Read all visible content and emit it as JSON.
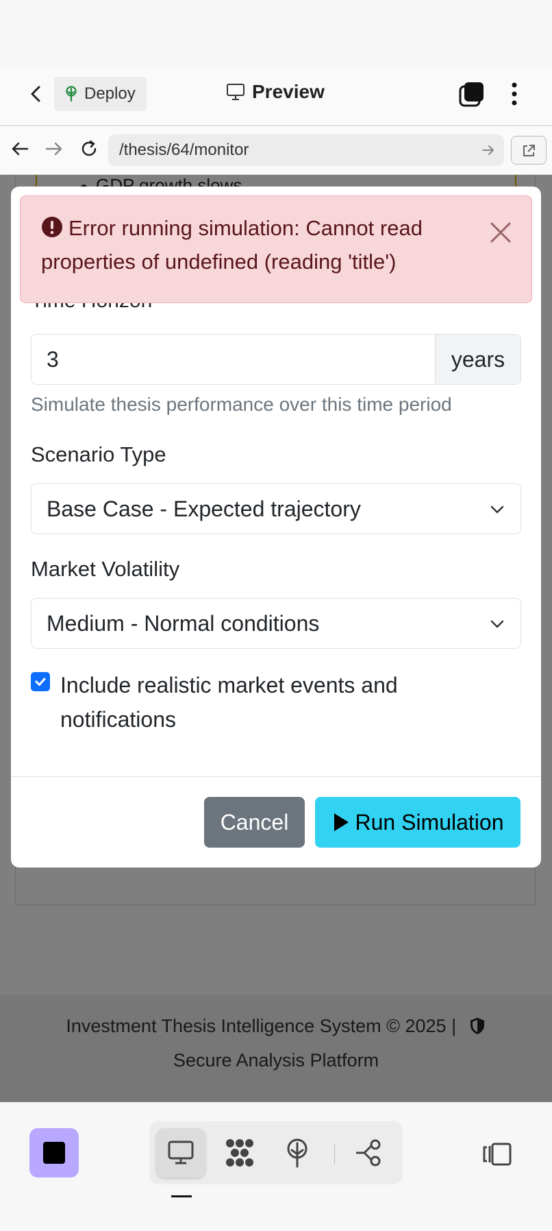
{
  "topbar": {
    "deploy_label": "Deploy",
    "preview_label": "Preview"
  },
  "addressbar": {
    "url": "/thesis/64/monitor"
  },
  "background_page": {
    "bullet_text": "GDP growth slows",
    "footer_line1": "Investment Thesis Intelligence System © 2025   |",
    "footer_line2": "Secure Analysis Platform"
  },
  "modal": {
    "peek_label": "Time Horizon",
    "alert": {
      "message": "Error running simulation: Cannot read properties of undefined (reading 'title')"
    },
    "time_horizon": {
      "value": "3",
      "unit": "years",
      "help": "Simulate thesis performance over this time period"
    },
    "scenario": {
      "label": "Scenario Type",
      "selected": "Base Case - Expected trajectory"
    },
    "volatility": {
      "label": "Market Volatility",
      "selected": "Medium - Normal conditions"
    },
    "events_checkbox": {
      "checked": true,
      "label": "Include realistic market events and notifications"
    },
    "buttons": {
      "cancel": "Cancel",
      "run": "Run Simulation"
    }
  },
  "colors": {
    "alert_bg": "#f8d7da",
    "alert_text": "#58151c",
    "primary": "#0d6efd",
    "info_button": "#31d2f2",
    "secondary_button": "#6c757d",
    "dock_app_accent": "#b9a8ff"
  },
  "icons": {
    "back": "chevron-left-icon",
    "deploy": "tree-icon",
    "preview": "monitor-icon",
    "tabs": "tabs-icon",
    "menu": "kebab-menu-icon",
    "nav_back": "arrow-left-icon",
    "nav_forward": "arrow-right-icon",
    "reload": "reload-icon",
    "open_external": "external-link-icon",
    "error": "exclamation-circle-icon",
    "close": "close-icon",
    "chevron": "chevron-down-icon",
    "play": "play-icon",
    "shield": "shield-icon"
  }
}
